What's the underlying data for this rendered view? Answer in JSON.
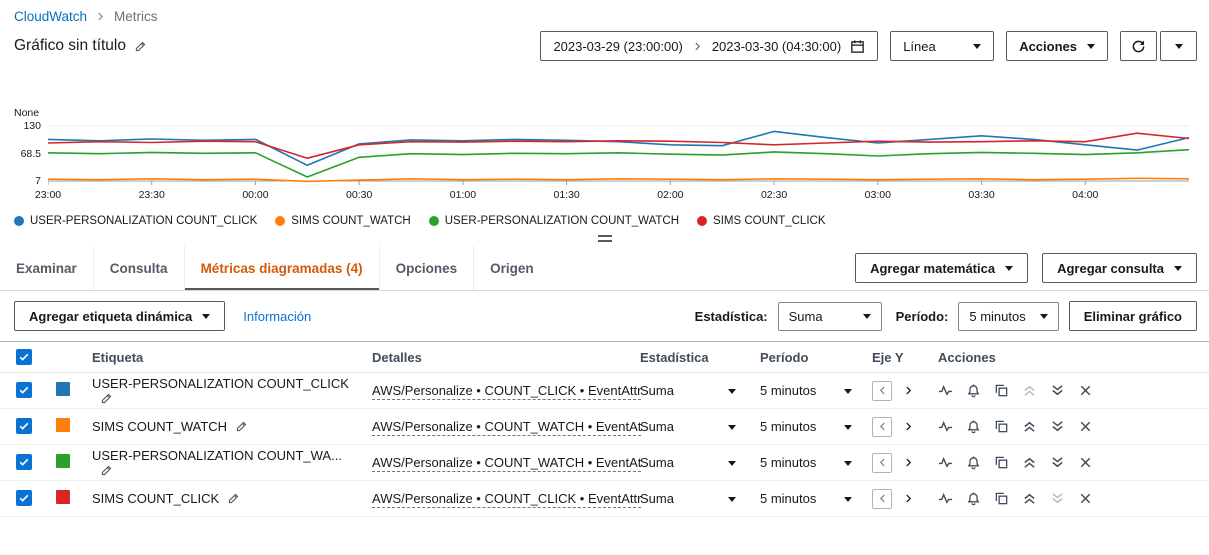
{
  "breadcrumb": {
    "items": [
      "CloudWatch",
      "Metrics"
    ]
  },
  "header": {
    "title": "Gráfico sin título",
    "date_start": "2023-03-29 (23:00:00)",
    "date_end": "2023-03-30 (04:30:00)",
    "chart_type_value": "Línea",
    "actions_label": "Acciones"
  },
  "chart_data": {
    "type": "line",
    "ylabel": "None",
    "yticks": [
      130,
      68.5,
      7
    ],
    "ylim": [
      7,
      130
    ],
    "x_ticks": [
      "23:00",
      "23:30",
      "00:00",
      "00:30",
      "01:00",
      "01:30",
      "02:00",
      "02:30",
      "03:00",
      "03:30",
      "04:00"
    ],
    "x_step_minutes": 15,
    "grid": "top-and-bottom-only",
    "legend_position": "bottom",
    "series": [
      {
        "name": "USER-PERSONALIZATION COUNT_CLICK",
        "color": "#1f77b4",
        "values": [
          100,
          97,
          101,
          98,
          100,
          42,
          90,
          99,
          97,
          100,
          98,
          95,
          88,
          86,
          118,
          104,
          92,
          100,
          108,
          100,
          88,
          76,
          104
        ]
      },
      {
        "name": "SIMS COUNT_WATCH",
        "color": "#ff7f0e",
        "values": [
          11,
          10,
          12,
          10,
          11,
          6,
          9,
          12,
          10,
          11,
          10,
          12,
          11,
          10,
          12,
          11,
          10,
          11,
          12,
          10,
          11,
          13,
          12
        ]
      },
      {
        "name": "USER-PERSONALIZATION COUNT_WATCH",
        "color": "#2ca02c",
        "values": [
          70,
          68,
          71,
          69,
          70,
          16,
          60,
          68,
          66,
          69,
          68,
          70,
          67,
          65,
          72,
          68,
          63,
          68,
          71,
          69,
          66,
          70,
          77
        ]
      },
      {
        "name": "SIMS COUNT_CLICK",
        "color": "#d62728",
        "values": [
          92,
          95,
          93,
          96,
          95,
          58,
          88,
          95,
          94,
          96,
          95,
          97,
          96,
          93,
          88,
          92,
          96,
          94,
          95,
          97,
          95,
          114,
          102
        ]
      }
    ]
  },
  "tabs": {
    "items": [
      {
        "label": "Examinar",
        "active": false
      },
      {
        "label": "Consulta",
        "active": false
      },
      {
        "label": "Métricas diagramadas (4)",
        "active": true
      },
      {
        "label": "Opciones",
        "active": false
      },
      {
        "label": "Origen",
        "active": false
      }
    ],
    "add_math_label": "Agregar matemática",
    "add_query_label": "Agregar consulta"
  },
  "toolbar": {
    "add_dynamic_label": "Agregar etiqueta dinámica",
    "info_link": "Información",
    "statistic_label": "Estadística:",
    "statistic_value": "Suma",
    "period_label": "Período:",
    "period_value": "5 minutos",
    "delete_graph_label": "Eliminar gráfico"
  },
  "table": {
    "columns": [
      "Etiqueta",
      "Detalles",
      "Estadística",
      "Período",
      "Eje Y",
      "Acciones"
    ],
    "rows": [
      {
        "checked": true,
        "color": "#1f77b4",
        "label": "USER-PERSONALIZATION COUNT_CLICK",
        "details": "AWS/Personalize • COUNT_CLICK • EventAttr",
        "statistic": "Suma",
        "period": "5 minutos"
      },
      {
        "checked": true,
        "color": "#ff7f0e",
        "label": "SIMS COUNT_WATCH",
        "details": "AWS/Personalize • COUNT_WATCH • EventAt",
        "statistic": "Suma",
        "period": "5 minutos"
      },
      {
        "checked": true,
        "color": "#2ca02c",
        "label": "USER-PERSONALIZATION COUNT_WA...",
        "details": "AWS/Personalize • COUNT_WATCH • EventAt",
        "statistic": "Suma",
        "period": "5 minutos"
      },
      {
        "checked": true,
        "color": "#d62728",
        "label": "SIMS COUNT_CLICK",
        "details": "AWS/Personalize • COUNT_CLICK • EventAttr",
        "statistic": "Suma",
        "period": "5 minutos"
      }
    ]
  },
  "colors": {
    "link": "#0073bb",
    "active_tab": "#d45b07",
    "checkbox": "#0972d3"
  }
}
